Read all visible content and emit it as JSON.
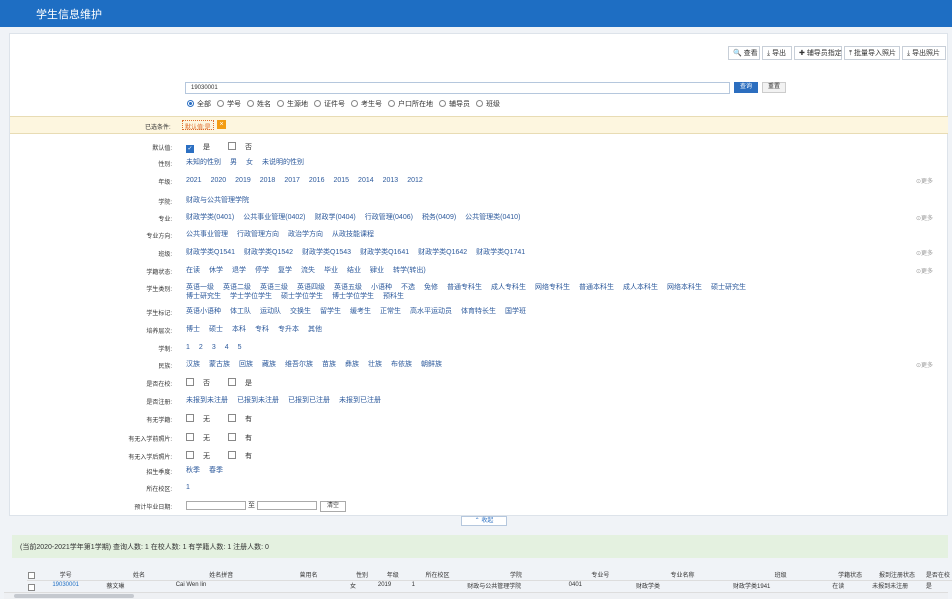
{
  "title": "学生信息维护",
  "toolbar": [
    "查看",
    "导出",
    "辅导员指定",
    "批量导入照片",
    "导出照片"
  ],
  "search": {
    "value": "19030001",
    "query_label": "查询",
    "reset_label": "重置"
  },
  "search_scope": {
    "options": [
      "全部",
      "学号",
      "姓名",
      "生源地",
      "证件号",
      "考生号",
      "户口所在地",
      "辅导员",
      "班级"
    ],
    "selected": "全部"
  },
  "selected_conditions": {
    "label": "已选条件:",
    "value": "默认值:是"
  },
  "filters": [
    {
      "label": "默认值:",
      "type": "check",
      "items": [
        {
          "text": "是",
          "checked": true
        },
        {
          "text": "否",
          "checked": false
        }
      ]
    },
    {
      "label": "性别:",
      "type": "opts",
      "items": [
        "未知的性别",
        "男",
        "女",
        "未说明的性别"
      ]
    },
    {
      "label": "年级:",
      "type": "opts",
      "items": [
        "2021",
        "2020",
        "2019",
        "2018",
        "2017",
        "2016",
        "2015",
        "2014",
        "2013",
        "2012"
      ],
      "more": true
    },
    {
      "label": "学院:",
      "type": "opts",
      "items": [
        "财政与公共管理学院"
      ]
    },
    {
      "label": "专业:",
      "type": "opts",
      "items": [
        "财政学类(0401)",
        "公共事业管理(0402)",
        "财政学(0404)",
        "行政管理(0406)",
        "税务(0409)",
        "公共管理类(0410)"
      ],
      "more": true
    },
    {
      "label": "专业方向:",
      "type": "opts",
      "items": [
        "公共事业管理",
        "行政管理方向",
        "政治学方向",
        "从政技能课程"
      ]
    },
    {
      "label": "班级:",
      "type": "opts",
      "items": [
        "财政学类Q1541",
        "财政学类Q1542",
        "财政学类Q1543",
        "财政学类Q1641",
        "财政学类Q1642",
        "财政学类Q1741"
      ],
      "more": true
    },
    {
      "label": "学籍状态:",
      "type": "opts",
      "items": [
        "在读",
        "休学",
        "退学",
        "停学",
        "复学",
        "流失",
        "毕业",
        "结业",
        "肄业",
        "转学(转出)"
      ],
      "more": true
    },
    {
      "label": "学生类别:",
      "type": "opts2",
      "items": [
        "英语一级",
        "英语二级",
        "英语三级",
        "英语四级",
        "英语五级",
        "小语种",
        "不选",
        "免修",
        "普通专科生",
        "成人专科生",
        "网络专科生",
        "普通本科生",
        "成人本科生",
        "网络本科生",
        "硕士研究生"
      ],
      "items2": [
        "博士研究生",
        "学士学位学生",
        "硕士学位学生",
        "博士学位学生",
        "预科生"
      ]
    },
    {
      "label": "学生标记:",
      "type": "opts",
      "items": [
        "英语小语种",
        "体工队",
        "运动队",
        "交换生",
        "留学生",
        "缓考生",
        "正常生",
        "高水平运动员",
        "体育特长生",
        "国学班"
      ]
    },
    {
      "label": "培养层次:",
      "type": "opts",
      "items": [
        "博士",
        "硕士",
        "本科",
        "专科",
        "专升本",
        "其他"
      ]
    },
    {
      "label": "学制:",
      "type": "opts",
      "items": [
        "1",
        "2",
        "3",
        "4",
        "5"
      ]
    },
    {
      "label": "民族:",
      "type": "opts",
      "items": [
        "汉族",
        "蒙古族",
        "回族",
        "藏族",
        "维吾尔族",
        "苗族",
        "彝族",
        "壮族",
        "布依族",
        "朝鲜族"
      ],
      "more": true
    },
    {
      "label": "是否在校:",
      "type": "check",
      "items": [
        {
          "text": "否",
          "checked": false
        },
        {
          "text": "是",
          "checked": false
        }
      ]
    },
    {
      "label": "是否注册:",
      "type": "opts",
      "items": [
        "未报到未注册",
        "已报到未注册",
        "已报到已注册",
        "未报到已注册"
      ]
    },
    {
      "label": "有无学籍:",
      "type": "check",
      "items": [
        {
          "text": "无",
          "checked": false
        },
        {
          "text": "有",
          "checked": false
        }
      ]
    },
    {
      "label": "有无入学前照片:",
      "type": "check",
      "items": [
        {
          "text": "无",
          "checked": false
        },
        {
          "text": "有",
          "checked": false
        }
      ]
    },
    {
      "label": "有无入学后照片:",
      "type": "check",
      "items": [
        {
          "text": "无",
          "checked": false
        },
        {
          "text": "有",
          "checked": false
        }
      ]
    },
    {
      "label": "招生季度:",
      "type": "opts",
      "items": [
        "秋季",
        "春季"
      ]
    },
    {
      "label": "所在校区:",
      "type": "opts",
      "items": [
        "1"
      ]
    },
    {
      "label": "预计毕业日期:",
      "type": "date",
      "to": "至",
      "clear": "清空"
    }
  ],
  "more_label": "更多",
  "collapse_label": "收起",
  "stats": "(当前2020-2021学年第1学期)  查询人数: 1  在校人数: 1  有学籍人数: 1  注册人数: 0",
  "table": {
    "columns": [
      "学号",
      "姓名",
      "姓名拼音",
      "曾用名",
      "性别",
      "年级",
      "所在校区",
      "学院",
      "专业号",
      "专业名称",
      "班级",
      "学籍状态",
      "报到注册状态",
      "是否在校"
    ],
    "rows": [
      [
        "19030001",
        "蔡文琳",
        "Cai Wen lin",
        "",
        "女",
        "2019",
        "1",
        "财政与公共管理学院",
        "0401",
        "财政学类",
        "财政学类1941",
        "在读",
        "未报到未注册",
        "是"
      ]
    ]
  },
  "accent": "#1e6ec3"
}
